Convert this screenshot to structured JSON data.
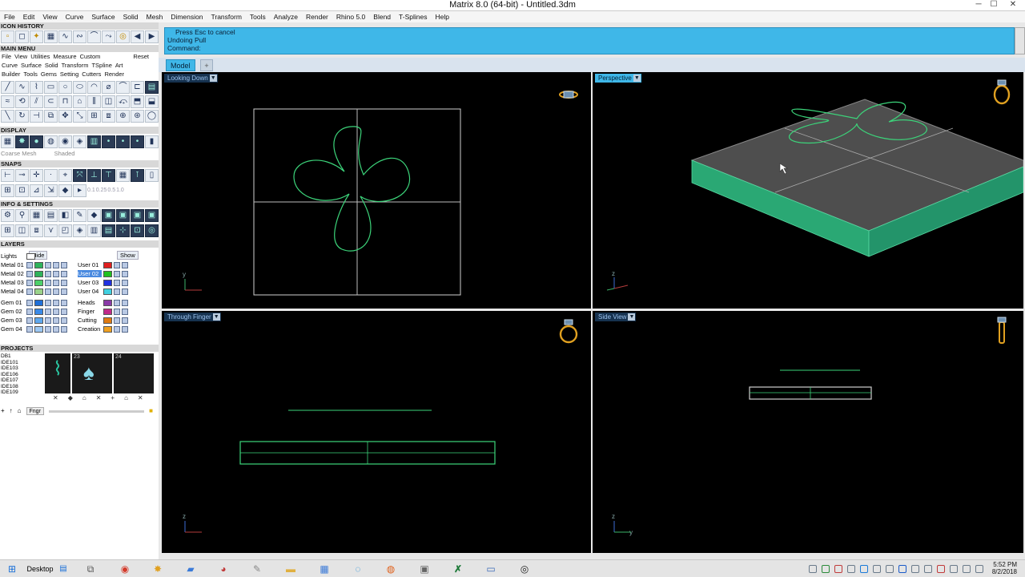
{
  "window": {
    "title": "Matrix 8.0 (64-bit) - Untitled.3dm",
    "min": "─",
    "max": "☐",
    "close": "✕"
  },
  "menu": [
    "File",
    "Edit",
    "View",
    "Curve",
    "Surface",
    "Solid",
    "Mesh",
    "Dimension",
    "Transform",
    "Tools",
    "Analyze",
    "Render",
    "Rhino 5.0",
    "Blend",
    "T-Splines",
    "Help"
  ],
  "left": {
    "icon_history": "ICON HISTORY",
    "main_menu": "MAIN MENU",
    "main_items": [
      "File",
      "View",
      "Utilities",
      "Measure",
      "Custom"
    ],
    "reset": "Reset",
    "sub1": [
      "Curve",
      "Surface",
      "Solid",
      "Transform",
      "TSpline",
      "Art"
    ],
    "sub2": [
      "Builder",
      "Tools",
      "Gems",
      "Setting",
      "Cutters",
      "Render"
    ],
    "display": "DISPLAY",
    "display_modes": [
      "Coarse Mesh",
      "Shaded"
    ],
    "snaps": "SNAPS",
    "snap_values": [
      "0.1",
      "0.25",
      "0.5",
      "1.0"
    ],
    "info": "INFO & SETTINGS",
    "layers": "LAYERS",
    "hide": "Hide",
    "show": "Show",
    "layers_left": [
      "Lights",
      "Metal 01",
      "Metal 02",
      "Metal 03",
      "Metal 04",
      "Gem 01",
      "Gem 02",
      "Gem 03",
      "Gem 04"
    ],
    "layers_right": [
      "User 01",
      "User 02",
      "User 03",
      "User 04",
      "Heads",
      "Finger",
      "Cutting",
      "Creation"
    ],
    "projects": "PROJECTS",
    "project_items": [
      "DB1",
      "IDE101",
      "IDE103",
      "IDE106",
      "IDE107",
      "IDE108",
      "IDE109"
    ],
    "thumb_nums": [
      "23",
      "24"
    ],
    "finger_btn": "Fngr"
  },
  "command": {
    "line1": "Press Esc to cancel",
    "line2": "Undoing Pull",
    "prompt": "Command:"
  },
  "tabs": {
    "model": "Model",
    "add": "+"
  },
  "viewports": {
    "top": "Looking Down",
    "persp": "Perspective",
    "front": "Through Finger",
    "side": "Side View",
    "dropdown": "▼"
  },
  "axes": {
    "y": "y",
    "z": "z"
  },
  "taskbar": {
    "desktop": "Desktop",
    "time": "5:52 PM",
    "date": "8/2/2018"
  },
  "colors": {
    "accent": "#3fb7e8",
    "curve": "#3cd47a",
    "slab_top": "#555555",
    "slab_side": "#2bb07a"
  }
}
